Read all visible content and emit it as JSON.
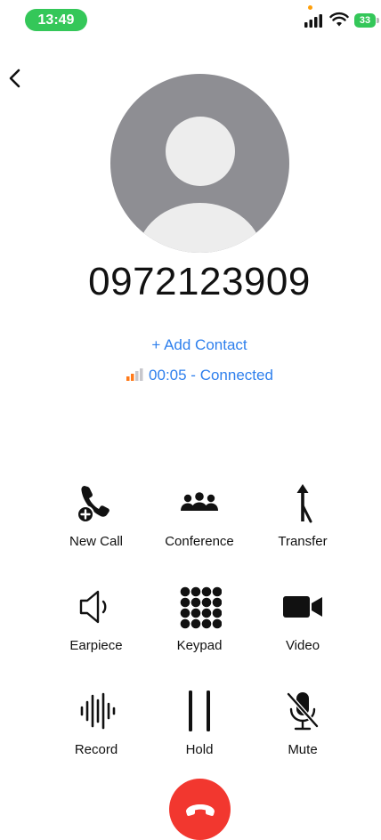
{
  "status_bar": {
    "time": "13:49",
    "battery": "33"
  },
  "call": {
    "number": "0972123909",
    "add_contact": "+ Add Contact",
    "status": "00:05 - Connected"
  },
  "actions": [
    {
      "label": "New Call",
      "icon": "new-call-icon"
    },
    {
      "label": "Conference",
      "icon": "conference-icon"
    },
    {
      "label": "Transfer",
      "icon": "transfer-icon"
    },
    {
      "label": "Earpiece",
      "icon": "speaker-icon"
    },
    {
      "label": "Keypad",
      "icon": "keypad-icon"
    },
    {
      "label": "Video",
      "icon": "video-camera-icon"
    },
    {
      "label": "Record",
      "icon": "waveform-icon"
    },
    {
      "label": "Hold",
      "icon": "pause-icon"
    },
    {
      "label": "Mute",
      "icon": "mic-off-icon"
    }
  ],
  "colors": {
    "accent": "#2f80ed",
    "status_green": "#34c759",
    "end_call": "#f2372f"
  }
}
